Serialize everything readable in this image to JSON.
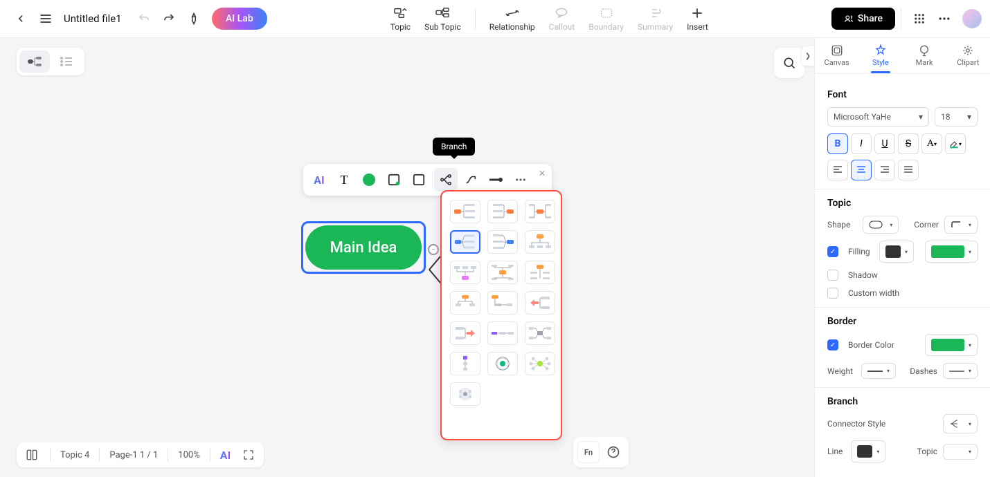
{
  "header": {
    "title": "Untitled file1",
    "ai_lab": "AI Lab",
    "share": "Share",
    "toolbar": [
      {
        "label": "Topic",
        "disabled": false
      },
      {
        "label": "Sub Topic",
        "disabled": false
      },
      {
        "label": "Relationship",
        "disabled": false
      },
      {
        "label": "Callout",
        "disabled": true
      },
      {
        "label": "Boundary",
        "disabled": true
      },
      {
        "label": "Summary",
        "disabled": true
      },
      {
        "label": "Insert",
        "disabled": false
      }
    ]
  },
  "canvas": {
    "main_node": "Main Idea",
    "tooltip": "Branch"
  },
  "bottom": {
    "topic_count": "Topic 4",
    "page": "Page-1  1 / 1",
    "zoom": "100%"
  },
  "sidepanel": {
    "tabs": [
      "Canvas",
      "Style",
      "Mark",
      "Clipart"
    ],
    "active_tab": 1,
    "font": {
      "title": "Font",
      "family": "Microsoft YaHe",
      "size": "18"
    },
    "topic": {
      "title": "Topic",
      "shape_label": "Shape",
      "corner_label": "Corner",
      "filling_label": "Filling",
      "shadow_label": "Shadow",
      "custom_width_label": "Custom width",
      "fill_color": "#333333",
      "accent_color": "#1bb757"
    },
    "border": {
      "title": "Border",
      "color_label": "Border Color",
      "weight_label": "Weight",
      "dashes_label": "Dashes",
      "color": "#1bb757"
    },
    "branch": {
      "title": "Branch",
      "connector_label": "Connector Style",
      "line_label": "Line",
      "topic_label": "Topic",
      "line_color": "#333333"
    }
  }
}
